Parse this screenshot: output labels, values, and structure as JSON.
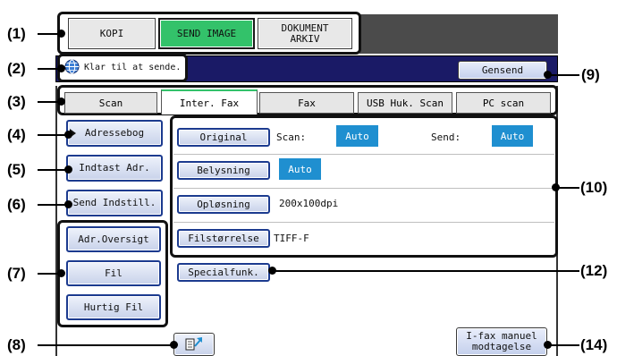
{
  "callouts": {
    "c1": "(1)",
    "c2": "(2)",
    "c3": "(3)",
    "c4": "(4)",
    "c5": "(5)",
    "c6": "(6)",
    "c7": "(7)",
    "c8": "(8)",
    "c9": "(9)",
    "c10": "(10)",
    "c12": "(12)",
    "c14": "(14)"
  },
  "mode_tabs": {
    "kopi": "KOPI",
    "send_image": "SEND IMAGE",
    "dokument_arkiv_1": "DOKUMENT",
    "dokument_arkiv_2": "ARKIV"
  },
  "status": {
    "message": "Klar til at sende.",
    "resend": "Gensend"
  },
  "send_tabs": {
    "scan": "Scan",
    "inter_fax": "Inter. Fax",
    "fax": "Fax",
    "usb": "USB Huk. Scan",
    "pc_scan": "PC scan"
  },
  "left_buttons": {
    "address_book": "Adressebog",
    "enter_address": "Indtast Adr.",
    "send_settings": "Send Indstill.",
    "address_overview": "Adr.Oversigt",
    "file": "Fil",
    "quick_file": "Hurtig Fil"
  },
  "settings": {
    "original_label": "Original",
    "scan_label": "Scan:",
    "scan_value": "Auto",
    "send_label": "Send:",
    "send_value": "Auto",
    "exposure_label": "Belysning",
    "exposure_value": "Auto",
    "resolution_label": "Opløsning",
    "resolution_value": "200x100dpi",
    "filesize_label": "Filstørrelse",
    "filesize_value": "TIFF-F",
    "special_label": "Specialfunk."
  },
  "bottom": {
    "manual_receive_1": "I-fax manuel",
    "manual_receive_2": "modtagelse"
  },
  "colors": {
    "accent_blue": "#1f8fd0",
    "status_bar": "#1a1a66",
    "active_tab": "#33c26a"
  }
}
